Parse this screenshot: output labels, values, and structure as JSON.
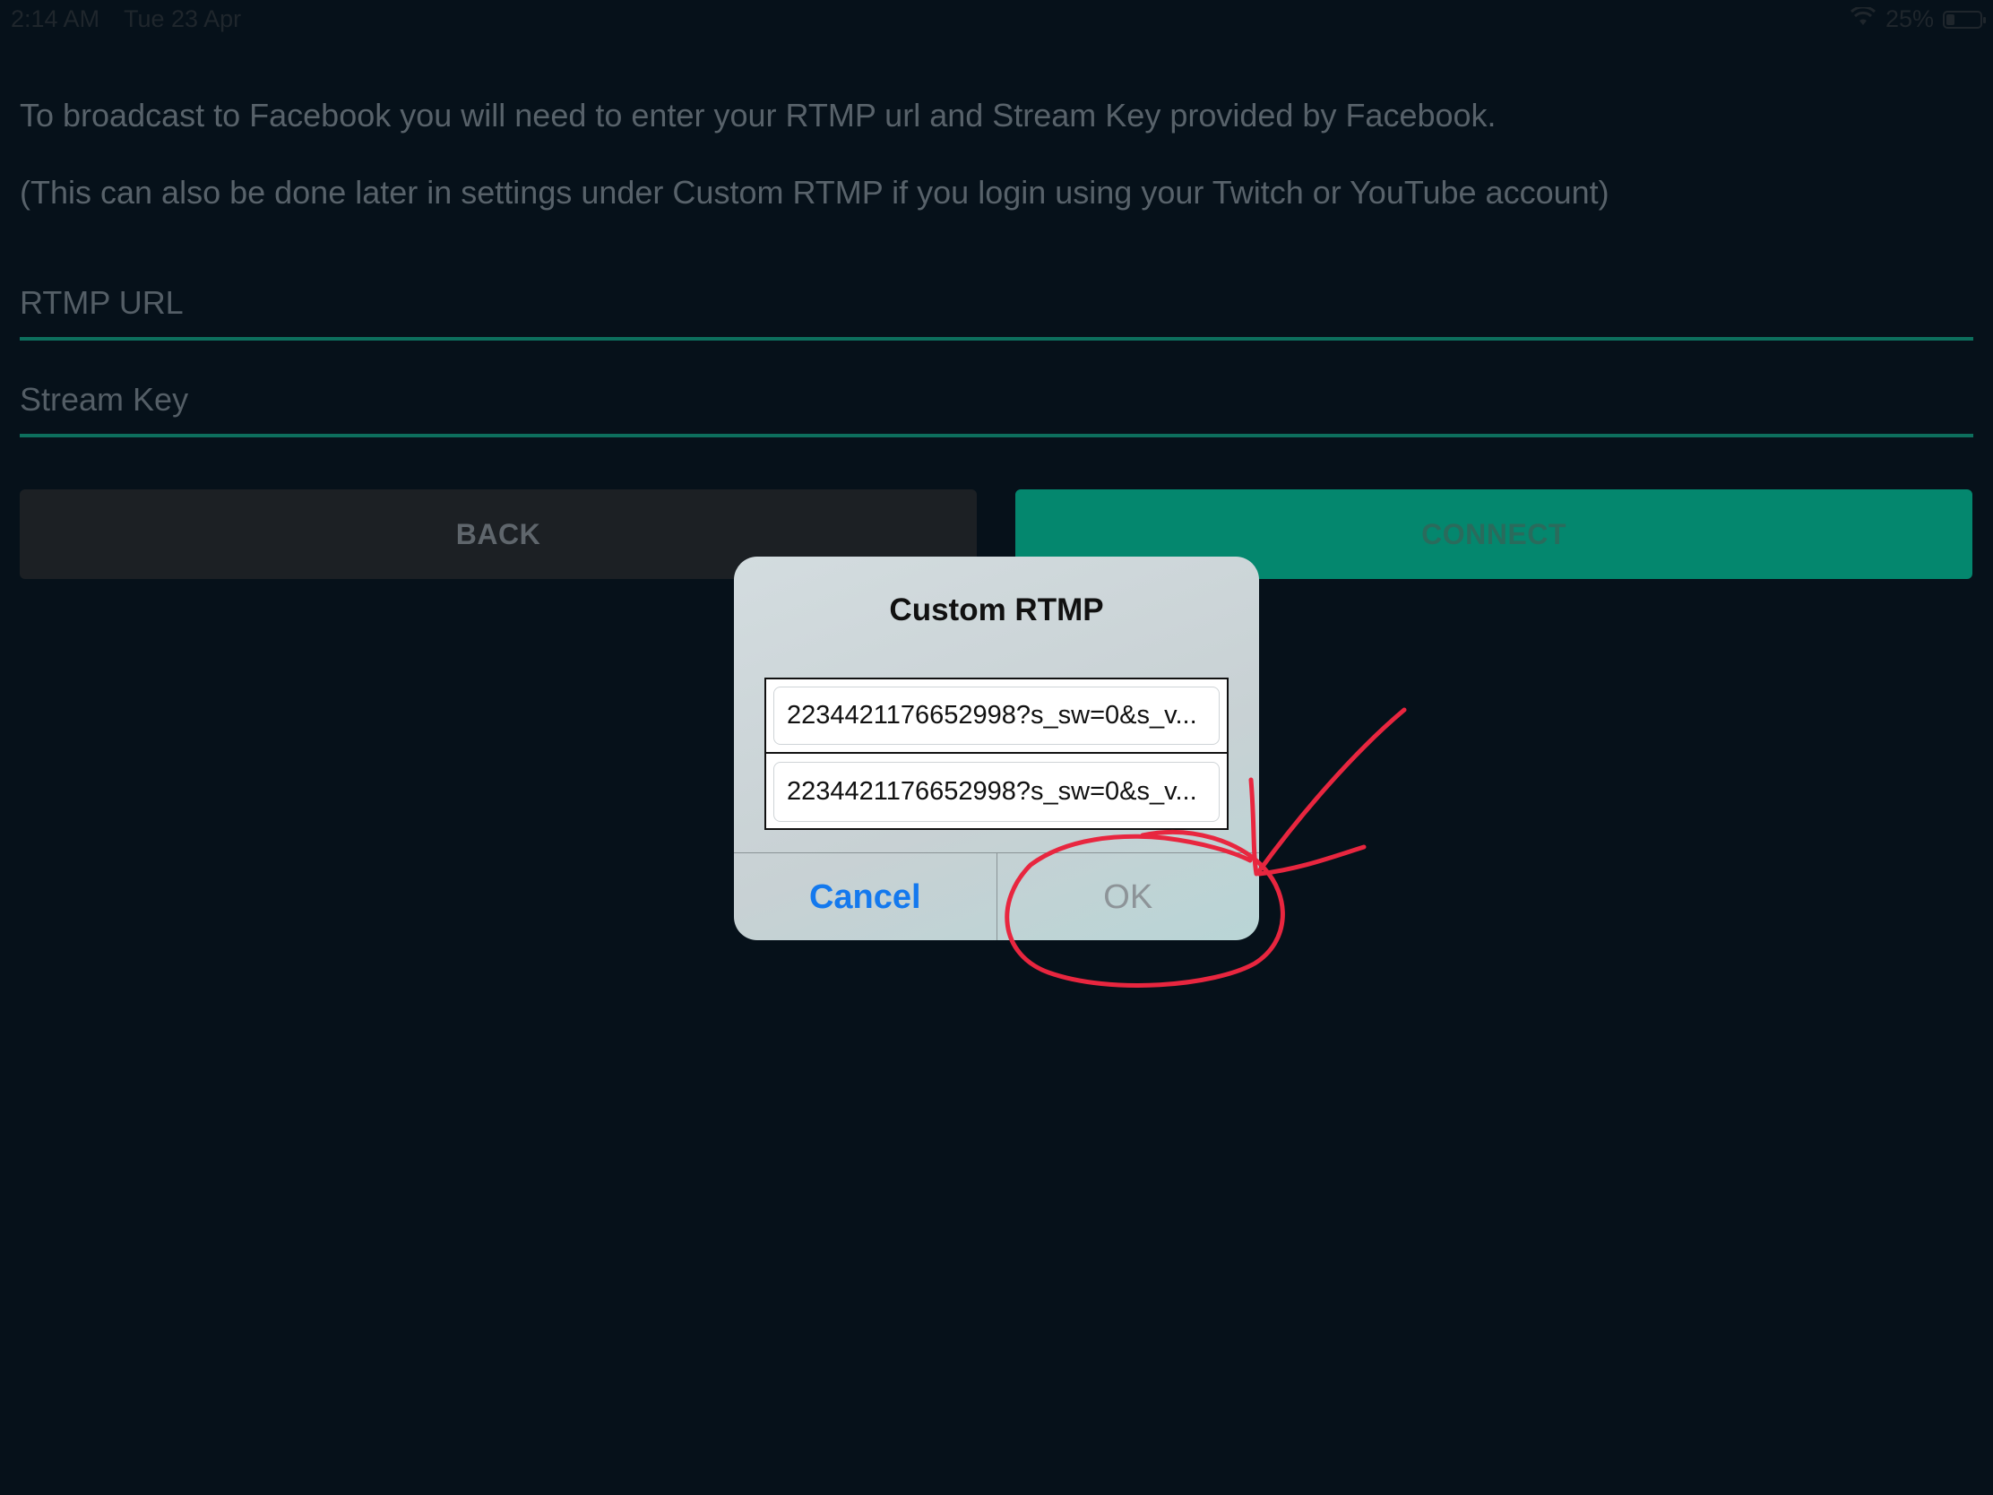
{
  "status_bar": {
    "time": "2:14 AM",
    "date": "Tue 23 Apr",
    "battery_percent": "25%",
    "battery_level": 0.25,
    "wifi_icon": "wifi-icon",
    "battery_icon": "battery-icon"
  },
  "intro": {
    "line1": "To broadcast to Facebook you will need to enter your RTMP url and Stream Key provided by Facebook.",
    "line2": "(This can also be done later in settings under Custom RTMP if you login using your Twitch or YouTube account)"
  },
  "form": {
    "rtmp_url_placeholder": "RTMP URL",
    "stream_key_placeholder": "Stream Key"
  },
  "buttons": {
    "back": "BACK",
    "connect": "CONNECT"
  },
  "dialog": {
    "title": "Custom RTMP",
    "field1_value": "2234421176652998?s_sw=0&s_v...",
    "field2_value": "2234421176652998?s_sw=0&s_v...",
    "cancel": "Cancel",
    "ok": "OK"
  },
  "colors": {
    "background": "#06111a",
    "accent": "#04876e",
    "underline": "#0d6f5d",
    "dialog_link": "#1479ee",
    "annotation": "#e8263f"
  }
}
